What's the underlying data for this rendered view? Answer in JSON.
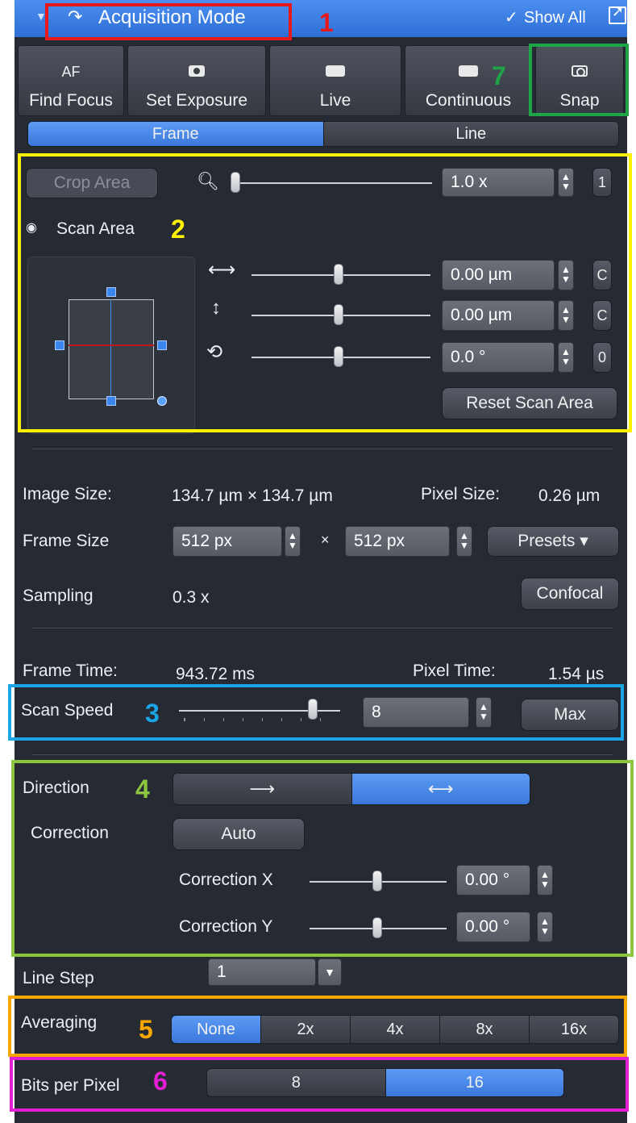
{
  "header": {
    "title": "Acquisition Mode",
    "show_all": "Show All",
    "collapse_icon": "chevron-down-icon",
    "mode_icon": "redo-arrow-icon",
    "popout_icon": "popout-icon"
  },
  "actions": {
    "find_focus_top": "AF",
    "find_focus": "Find Focus",
    "set_exposure": "Set Exposure",
    "live": "Live",
    "continuous": "Continuous",
    "snap": "Snap"
  },
  "scan_mode": {
    "options": [
      "Frame",
      "Line"
    ],
    "selected": "Frame"
  },
  "zoom": {
    "crop_area": "Crop Area",
    "value": "1.0 x",
    "reset": "1"
  },
  "scan_area": {
    "label": "Scan Area",
    "offset_x": "0.00 µm",
    "offset_x_btn": "C",
    "offset_y": "0.00 µm",
    "offset_y_btn": "C",
    "rotation": "0.0 °",
    "rotation_btn": "0",
    "reset": "Reset Scan Area"
  },
  "image": {
    "size_label": "Image Size:",
    "size_value": "134.7 µm × 134.7 µm",
    "pixel_label": "Pixel Size:",
    "pixel_value": "0.26 µm",
    "frame_label": "Frame Size",
    "frame_x": "512 px",
    "times": "×",
    "frame_y": "512 px",
    "presets": "Presets ▾",
    "sampling_label": "Sampling",
    "sampling_value": "0.3 x",
    "confocal": "Confocal"
  },
  "timing": {
    "frame_time_label": "Frame Time:",
    "frame_time": "943.72 ms",
    "pixel_time_label": "Pixel Time:",
    "pixel_time": "1.54 µs"
  },
  "scan_speed": {
    "label": "Scan Speed",
    "value": "8",
    "max": "Max"
  },
  "direction": {
    "label": "Direction",
    "correction_label": "Correction",
    "auto": "Auto",
    "corr_x_label": "Correction X",
    "corr_x": "0.00 °",
    "corr_y_label": "Correction Y",
    "corr_y": "0.00 °"
  },
  "line_step": {
    "label": "Line Step",
    "value": "1"
  },
  "averaging": {
    "label": "Averaging",
    "options": [
      "None",
      "2x",
      "4x",
      "8x",
      "16x"
    ],
    "selected": "None"
  },
  "bits": {
    "label": "Bits per Pixel",
    "options": [
      "8",
      "16"
    ],
    "selected": "16"
  },
  "annotations": [
    "1",
    "2",
    "3",
    "4",
    "5",
    "6",
    "7"
  ],
  "colors": {
    "panel": "#262a33",
    "accent": "#3a78db",
    "anno1": "#e8191c",
    "anno2": "#fff200",
    "anno3": "#1aa6e6",
    "anno4": "#8dc63f",
    "anno5": "#f7a800",
    "anno6": "#e21fd2",
    "anno7": "#1fa548"
  }
}
